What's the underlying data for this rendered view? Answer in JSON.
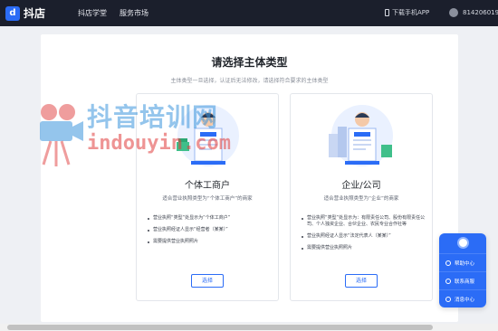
{
  "topbar": {
    "logo_text": "抖店",
    "nav": [
      "抖店学堂",
      "服务市场"
    ],
    "download_app": "下载手机APP",
    "account_id": "814206019"
  },
  "page": {
    "title": "请选择主体类型",
    "subtitle": "主体类型一旦选择，认证后无法修改，请选择符合要求的主体类型"
  },
  "options": [
    {
      "title": "个体工商户",
      "desc": "适合营业执照类型为“个体工商户”的商家",
      "bullets": [
        "营业执照“类型”处显示为“个体工商户”",
        "营业执照经证人显示“经营者（某某）”",
        "需要提供营业执照照片"
      ],
      "button": "选择"
    },
    {
      "title": "企业/公司",
      "desc": "适合营业执照类型为“企业”的商家",
      "bullets": [
        "营业执照“类型”处显示为：有限责任公司、股份有限责任公司、个人独资企业、合伙企业、农民专业合作社等",
        "营业执照经证人显示“法定代表人（某某）”",
        "需要提供营业执照照片"
      ],
      "button": "选择"
    }
  ],
  "help_panel": {
    "items": [
      "帮助中心",
      "联系商服",
      "消息中心"
    ]
  },
  "watermark": {
    "cn": "抖音培训网",
    "en": "indouyin.com"
  },
  "colors": {
    "topbar": "#1b1f2c",
    "accent": "#2b6cf6",
    "background": "#eef0f4"
  }
}
